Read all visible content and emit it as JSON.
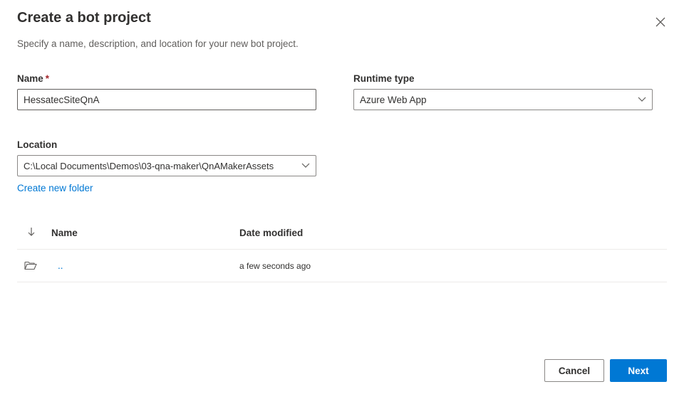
{
  "dialog": {
    "title": "Create a bot project",
    "subtitle": "Specify a name, description, and location for your new bot project."
  },
  "form": {
    "name_label": "Name",
    "name_required_mark": "*",
    "name_value": "HessatecSiteQnA",
    "runtime_label": "Runtime type",
    "runtime_value": "Azure Web App",
    "location_label": "Location",
    "location_value": "C:\\Local Documents\\Demos\\03-qna-maker\\QnAMakerAssets",
    "create_folder_link": "Create new folder"
  },
  "file_table": {
    "sort_icon": "arrow-down",
    "columns": [
      "Name",
      "Date modified"
    ],
    "rows": [
      {
        "icon": "folder-open",
        "name": "..",
        "date_modified": "a few seconds ago"
      }
    ]
  },
  "footer": {
    "cancel_label": "Cancel",
    "next_label": "Next"
  },
  "colors": {
    "accent": "#0078d4",
    "required": "#a4262c",
    "text": "#323130",
    "border": "#8a8886"
  }
}
